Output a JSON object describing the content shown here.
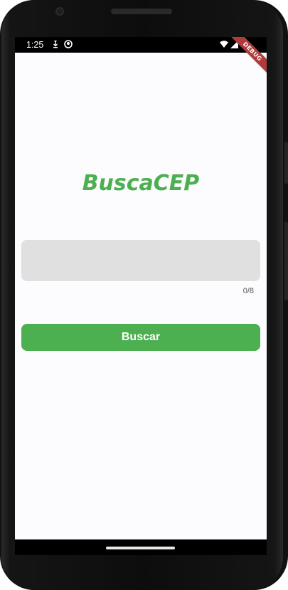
{
  "status_bar": {
    "time": "1:25",
    "icons": [
      "download-notification-icon",
      "app-notification-icon",
      "wifi-icon",
      "cell-signal-icon",
      "battery-icon"
    ]
  },
  "debug_banner": {
    "label": "DEBUG"
  },
  "app": {
    "title": "BuscaCEP",
    "cep_input": {
      "value": "",
      "placeholder": "",
      "counter": "0/8"
    },
    "search_button": {
      "label": "Buscar"
    }
  },
  "colors": {
    "accent": "#4caf50",
    "screen_background": "#fcfbfe",
    "input_background": "#e0e0e0",
    "debug_banner": "#b13a3a"
  }
}
